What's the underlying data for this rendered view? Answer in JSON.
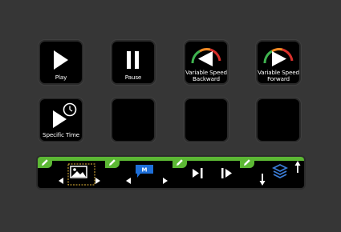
{
  "keys": [
    {
      "id": "play",
      "label": "Play",
      "icon": "play-icon"
    },
    {
      "id": "pause",
      "label": "Pause",
      "icon": "pause-icon"
    },
    {
      "id": "variable-speed-backward",
      "label": "Variable Speed\nBackward",
      "icon": "speed-backward-icon"
    },
    {
      "id": "variable-speed-forward",
      "label": "Variable Speed\nForward",
      "icon": "speed-forward-icon"
    },
    {
      "id": "specific-time",
      "label": "Specific Time",
      "icon": "play-clock-icon"
    },
    {
      "id": "empty-1",
      "label": ""
    },
    {
      "id": "empty-2",
      "label": ""
    },
    {
      "id": "empty-3",
      "label": ""
    }
  ],
  "dials": [
    {
      "id": "dial-1",
      "icon": "image-select-icon",
      "edit_icon": "pencil-icon"
    },
    {
      "id": "dial-2",
      "icon": "marker-icon",
      "marker_letter": "M",
      "edit_icon": "pencil-icon"
    },
    {
      "id": "dial-3",
      "icon": "frame-step-icon",
      "edit_icon": "pencil-icon"
    },
    {
      "id": "dial-4",
      "icon": "layers-icon",
      "edit_icon": "pencil-icon"
    }
  ],
  "colors": {
    "background": "#363636",
    "key_face": "#000000",
    "accent_green": "#5cb834",
    "marker_blue": "#1e6fd9",
    "layers_blue": "#3a7bd5",
    "gauge_green": "#3fb34f",
    "gauge_orange": "#f08a24",
    "gauge_red": "#d9302c"
  }
}
